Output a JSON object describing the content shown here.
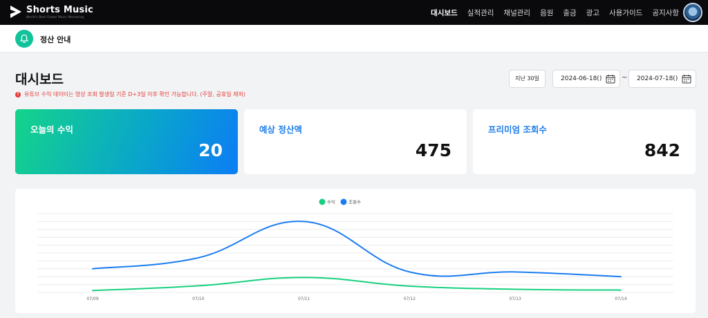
{
  "app": {
    "title": "Shorts Music",
    "subtitle": "World's Best Global Music Marketing"
  },
  "nav": {
    "items": [
      "대시보드",
      "실적관리",
      "채널관리",
      "음원",
      "출금",
      "광고",
      "사용가이드",
      "공지사항"
    ],
    "active": "대시보드"
  },
  "notice": {
    "text": "정산 안내"
  },
  "page": {
    "title": "대시보드",
    "warning": "유튜브 수익 데이터는 영상 조회 발생일 기준 D+3일 이후 확인 가능합니다. (주말, 공휴일 제외)"
  },
  "filters": {
    "range_label": "지난 30일",
    "start_date": "2024-06-18()",
    "end_date": "2024-07-18()",
    "separator": "~"
  },
  "cards": [
    {
      "label": "오늘의 수익",
      "value": "20"
    },
    {
      "label": "예상 정산액",
      "value": "475"
    },
    {
      "label": "프리미엄 조회수",
      "value": "842"
    }
  ],
  "colors": {
    "accent": "#1f7ee8",
    "green": "#16d07f",
    "blue": "#1a7cf0",
    "nav_bg": "#0a0a0d"
  },
  "chart_data": {
    "type": "line",
    "x": [
      "07/09",
      "07/10",
      "07/11",
      "07/12",
      "07/13",
      "07/14"
    ],
    "series": [
      {
        "name": "수익",
        "color": "#16d07f",
        "values": [
          1.2,
          4.2,
          9.5,
          4.0,
          2.0,
          1.5
        ]
      },
      {
        "name": "조회수",
        "color": "#1a7cf0",
        "values": [
          15,
          22,
          45,
          13,
          13,
          10
        ]
      }
    ],
    "ylim": [
      0,
      50
    ],
    "legend": "top-center",
    "grid": true
  }
}
